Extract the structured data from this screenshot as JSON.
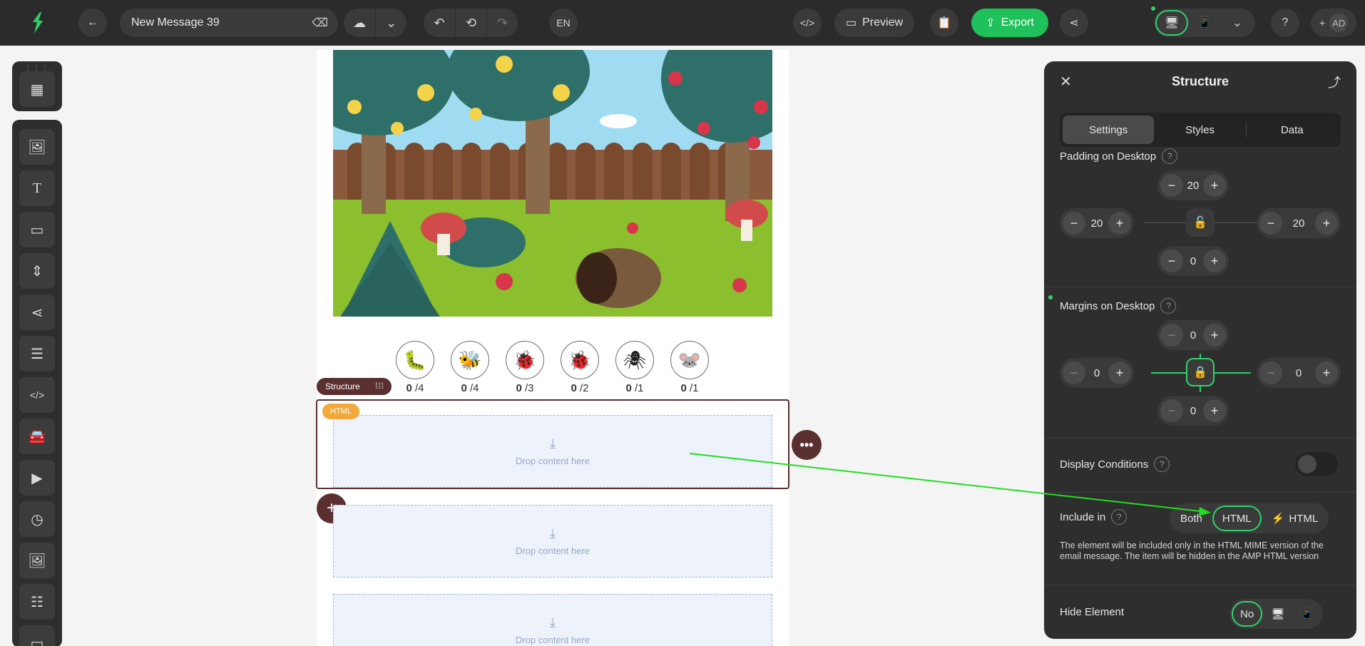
{
  "topbar": {
    "doc_title": "New Message 39",
    "language": "EN",
    "preview_label": "Preview",
    "export_label": "Export",
    "user_initials": "AD"
  },
  "canvas": {
    "structure_tag": "Structure",
    "html_tag": "HTML",
    "drop_text": "Drop content here",
    "bugs": [
      {
        "icon": "larva-icon",
        "glyph": "🐛",
        "count": "0",
        "total": "/4"
      },
      {
        "icon": "bee-icon",
        "glyph": "🐝",
        "count": "0",
        "total": "/4"
      },
      {
        "icon": "bug-icon",
        "glyph": "🐞",
        "count": "0",
        "total": "/3"
      },
      {
        "icon": "ladybug-icon",
        "glyph": "🐞",
        "count": "0",
        "total": "/2"
      },
      {
        "icon": "spider-icon",
        "glyph": "🕷",
        "count": "0",
        "total": "/1"
      },
      {
        "icon": "mouse-icon",
        "glyph": "🐭",
        "count": "0",
        "total": "/1"
      }
    ]
  },
  "panel": {
    "title": "Structure",
    "tabs": [
      "Settings",
      "Styles",
      "Data"
    ],
    "padding_label": "Padding on Desktop",
    "padding": {
      "top": "20",
      "left": "20",
      "right": "20",
      "bottom": "0"
    },
    "margins_label": "Margins on Desktop",
    "margins": {
      "top": "0",
      "left": "0",
      "right": "0",
      "bottom": "0"
    },
    "display_conditions_label": "Display Conditions",
    "include_in_label": "Include in",
    "include_options": [
      "Both",
      "HTML",
      "HTML"
    ],
    "include_note": "The element will be included only in the HTML MIME version of the email message. The item will be hidden in the AMP HTML version",
    "hide_element_label": "Hide Element",
    "hide_no_label": "No"
  },
  "colors": {
    "accent_green": "#1fc15a",
    "structure_brown": "#5a2f2f",
    "html_tag_orange": "#f2a93b"
  }
}
